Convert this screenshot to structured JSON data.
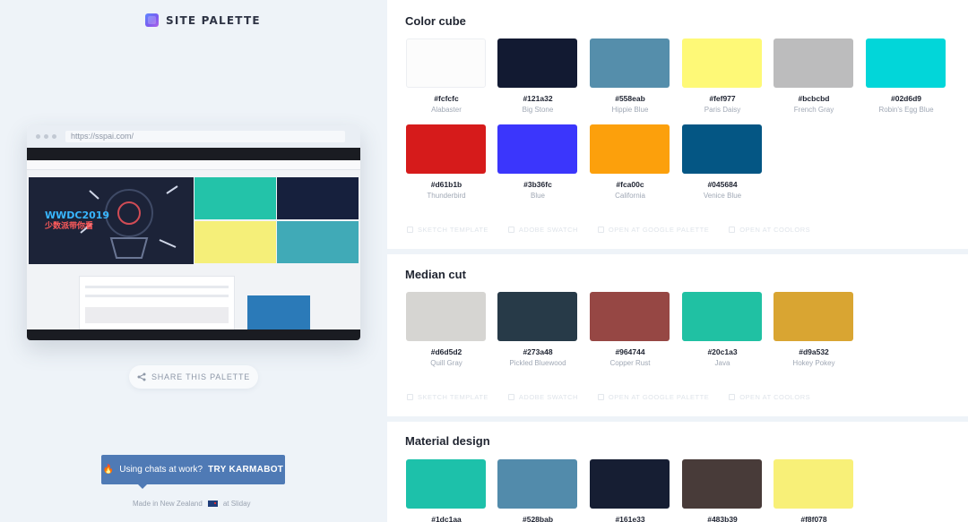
{
  "app": {
    "brand": "SITE PALETTE",
    "preview_url": "https://sspai.com/",
    "banner_line1": "WWDC2019",
    "banner_line2": "少数派带你看",
    "share_label": "SHARE THIS PALETTE",
    "karma_prefix": "Using chats at work?",
    "karma_action": "TRY KARMABOT",
    "made_in": "Made in New Zealand",
    "made_by": "at Sliday"
  },
  "actions": {
    "sketch": "SKETCH TEMPLATE",
    "adobe": "ADOBE SWATCH",
    "google": "OPEN AT GOOGLE PALETTE",
    "coolors": "OPEN AT COOLORS"
  },
  "sections": [
    {
      "title": "Color cube",
      "swatches": [
        {
          "hex": "#fcfcfc",
          "name": "Alabaster"
        },
        {
          "hex": "#121a32",
          "name": "Big Stone"
        },
        {
          "hex": "#558eab",
          "name": "Hippie Blue"
        },
        {
          "hex": "#fef977",
          "name": "Paris Daisy"
        },
        {
          "hex": "#bcbcbd",
          "name": "French Gray"
        },
        {
          "hex": "#02d6d9",
          "name": "Robin's Egg Blue"
        },
        {
          "hex": "#d61b1b",
          "name": "Thunderbird"
        },
        {
          "hex": "#3b36fc",
          "name": "Blue"
        },
        {
          "hex": "#fca00c",
          "name": "California"
        },
        {
          "hex": "#045684",
          "name": "Venice Blue"
        }
      ]
    },
    {
      "title": "Median cut",
      "swatches": [
        {
          "hex": "#d6d5d2",
          "name": "Quill Gray"
        },
        {
          "hex": "#273a48",
          "name": "Pickled Bluewood"
        },
        {
          "hex": "#964744",
          "name": "Copper Rust"
        },
        {
          "hex": "#20c1a3",
          "name": "Java"
        },
        {
          "hex": "#d9a532",
          "name": "Hokey Pokey"
        }
      ]
    },
    {
      "title": "Material design",
      "swatches": [
        {
          "hex": "#1dc1aa",
          "name": ""
        },
        {
          "hex": "#528bab",
          "name": ""
        },
        {
          "hex": "#161e33",
          "name": ""
        },
        {
          "hex": "#483b39",
          "name": ""
        },
        {
          "hex": "#f8f078",
          "name": ""
        }
      ]
    }
  ]
}
